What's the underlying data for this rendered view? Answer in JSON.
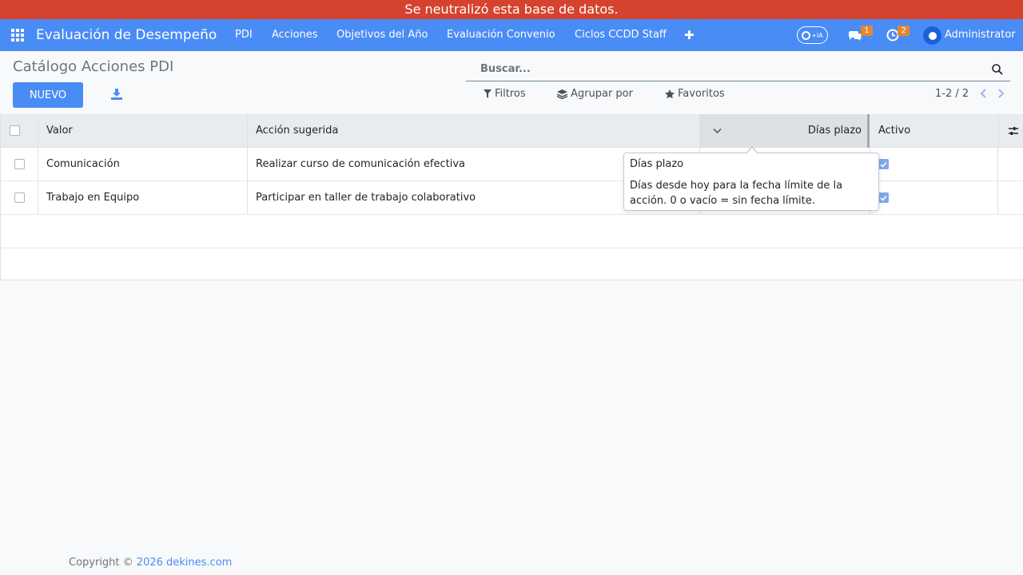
{
  "banner": {
    "text": "Se neutralizó esta base de datos."
  },
  "navbar": {
    "app_title": "Evaluación de Desempeño",
    "menu": [
      {
        "label": "PDI"
      },
      {
        "label": "Acciones"
      },
      {
        "label": "Objetivos del Año"
      },
      {
        "label": "Evaluación Convenio"
      },
      {
        "label": "Ciclos CCDD Staff"
      }
    ],
    "plus": "✚",
    "ia_label": "+IA",
    "messages_count": "1",
    "activities_count": "2",
    "user": "Administrator"
  },
  "control_panel": {
    "title": "Catálogo Acciones PDI",
    "new_button": "NUEVO",
    "search_placeholder": "Buscar...",
    "filters": "Filtros",
    "group_by": "Agrupar por",
    "favorites": "Favoritos",
    "pager": "1-2 / 2"
  },
  "table": {
    "columns": [
      {
        "label": "Valor"
      },
      {
        "label": "Acción sugerida"
      },
      {
        "label": "Días plazo"
      },
      {
        "label": "Activo"
      }
    ],
    "rows": [
      {
        "valor": "Comunicación",
        "accion": "Realizar curso de comunicación efectiva",
        "activo": true
      },
      {
        "valor": "Trabajo en Equipo",
        "accion": "Participar en taller de trabajo colaborativo",
        "activo": true
      }
    ]
  },
  "tooltip": {
    "title": "Días plazo",
    "body": "Días desde hoy para la fecha límite de la acción. 0 o vacío = sin fecha límite."
  },
  "footer": {
    "prefix": "Copyright © ",
    "link": "2026 dekines.com"
  },
  "colors": {
    "banner": "#d5432e",
    "navbar": "#4a8cf5",
    "primary": "#4a8cf5",
    "badge": "#e8852f"
  }
}
